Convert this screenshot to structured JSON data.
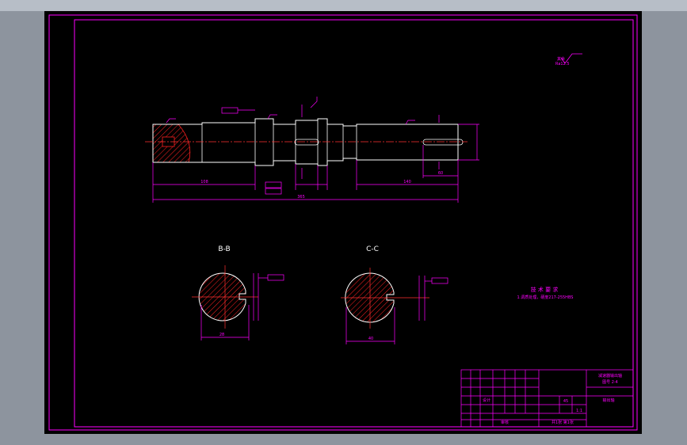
{
  "colors": {
    "background": "#000000",
    "frame": "#ff00ff",
    "shaft": "#ffffff",
    "hatch": "#ff2020",
    "centerline": "#ff3030",
    "workspace": "#8d949e"
  },
  "sections": {
    "bb_label": "B-B",
    "cc_label": "C-C"
  },
  "technical_requirements": {
    "title": "技 术 要 求",
    "line1": "1.调质处理，硬度217-255HBS"
  },
  "roughness_note": {
    "line1": "其余",
    "line2": "Ra12.5"
  },
  "dimensions": {
    "overall_length": "365",
    "left_segment": "108",
    "right_segment": "140",
    "keyway_right": "60",
    "bb_width": "28",
    "cc_width": "40"
  },
  "title_block": {
    "title_line1": "减速器输出轴",
    "title_line2": "图号 2-4",
    "part_name": "输出轴",
    "scale": "1:1",
    "material": "45",
    "sheet": "共1张 第1张",
    "designer": "设计",
    "checker": "审核"
  }
}
